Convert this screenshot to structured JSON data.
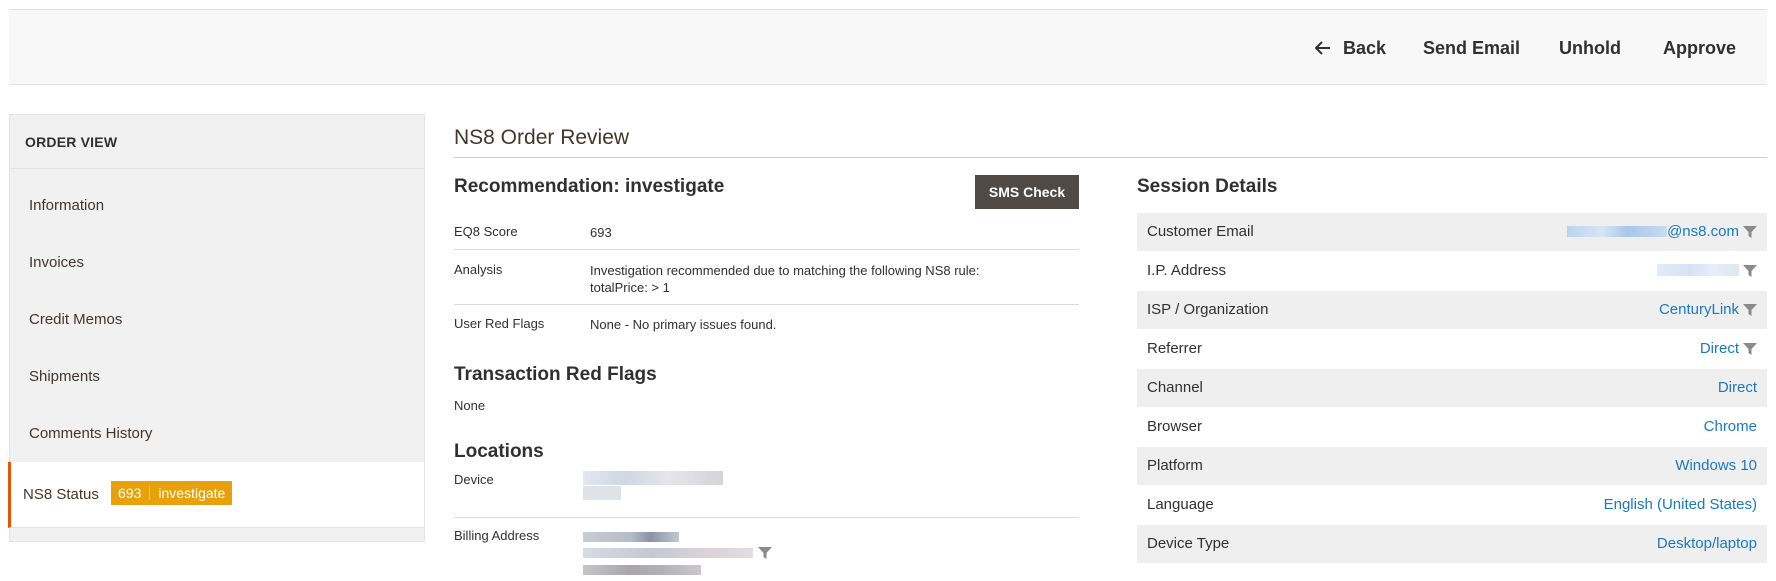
{
  "header": {
    "back_label": "Back",
    "send_email_label": "Send Email",
    "unhold_label": "Unhold",
    "approve_label": "Approve"
  },
  "sidebar": {
    "title": "ORDER VIEW",
    "items": [
      {
        "label": "Information"
      },
      {
        "label": "Invoices"
      },
      {
        "label": "Credit Memos"
      },
      {
        "label": "Shipments"
      },
      {
        "label": "Comments History"
      }
    ],
    "active_item": {
      "label": "NS8 Status",
      "badge_score": "693",
      "badge_status": "investigate"
    }
  },
  "main": {
    "heading": "NS8 Order Review",
    "recommendation_title": "Recommendation: investigate",
    "sms_button": "SMS Check",
    "rows": [
      {
        "label": "EQ8 Score",
        "value": "693"
      },
      {
        "label": "Analysis",
        "value_line1": "Investigation recommended due to matching the following NS8 rule:",
        "value_line2": "totalPrice: > 1"
      },
      {
        "label": "User Red Flags",
        "value": "None - No primary issues found."
      }
    ],
    "transaction_title": "Transaction Red Flags",
    "transaction_value": "None",
    "locations_title": "Locations",
    "device_label": "Device",
    "billing_label": "Billing Address"
  },
  "session": {
    "title": "Session Details",
    "rows": [
      {
        "label": "Customer Email",
        "value": "@ns8.com"
      },
      {
        "label": "I.P. Address",
        "value": ""
      },
      {
        "label": "ISP / Organization",
        "value": "CenturyLink"
      },
      {
        "label": "Referrer",
        "value": "Direct"
      },
      {
        "label": "Channel",
        "value": "Direct"
      },
      {
        "label": "Browser",
        "value": "Chrome"
      },
      {
        "label": "Platform",
        "value": "Windows 10"
      },
      {
        "label": "Language",
        "value": "English (United States)"
      },
      {
        "label": "Device Type",
        "value": "Desktop/laptop"
      }
    ]
  },
  "colors": {
    "accent": "#eb5202",
    "badge": "#e8a10a",
    "link": "#1979c3",
    "button_dark": "#514943"
  }
}
